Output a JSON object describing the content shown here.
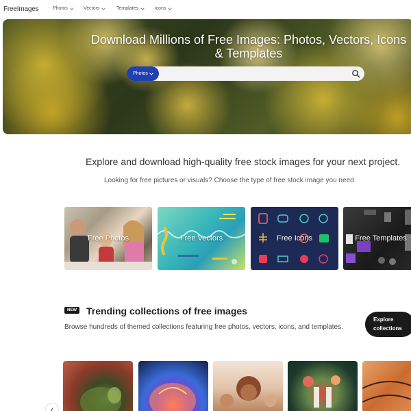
{
  "header": {
    "logo": "FreeImages",
    "nav": [
      {
        "label": "Photos"
      },
      {
        "label": "Vectors"
      },
      {
        "label": "Templates"
      },
      {
        "label": "icons"
      }
    ]
  },
  "hero": {
    "title": "Download Millions of Free Images: Photos, Vectors, Icons & Templates",
    "search": {
      "type_label": "Photos",
      "placeholder": ""
    }
  },
  "intro": {
    "heading": "Explore and download high-quality free stock images for your next project.",
    "subheading": "Looking for free pictures or visuals? Choose the type of free stock image you need"
  },
  "categories": [
    {
      "label": "Free Photos"
    },
    {
      "label": "Free Vectors"
    },
    {
      "label": "Free Icons"
    },
    {
      "label": "Free Templates"
    }
  ],
  "trending": {
    "badge": "NEW",
    "title": "Trending collections of free images",
    "description": "Browse hundreds of themed collections featuring free photos, vectors, icons, and templates.",
    "explore_label_line1": "Explore",
    "explore_label_line2": "collections"
  },
  "colors": {
    "accent": "#1f3fb3",
    "dark_button": "#1a1a1a"
  }
}
